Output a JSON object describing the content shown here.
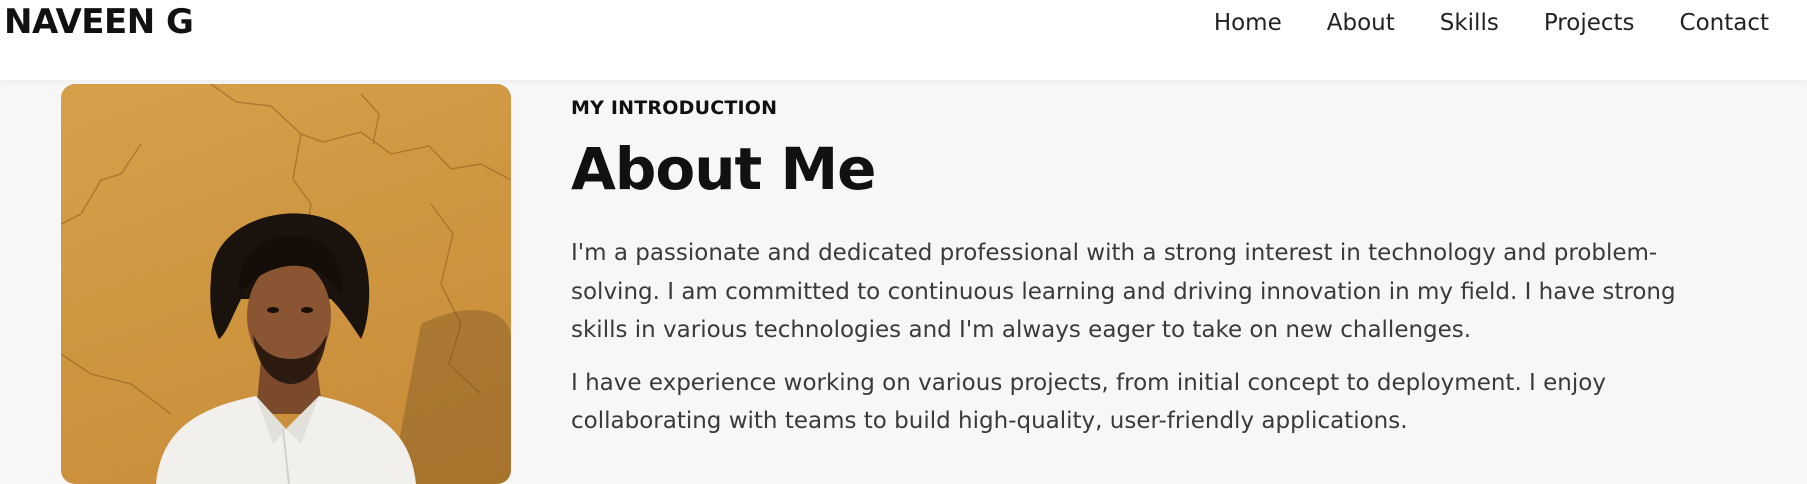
{
  "header": {
    "logo": "NAVEEN G",
    "nav": [
      "Home",
      "About",
      "Skills",
      "Projects",
      "Contact"
    ]
  },
  "about": {
    "eyebrow": "MY INTRODUCTION",
    "title": "About Me",
    "paragraphs": [
      "I'm a passionate and dedicated professional with a strong interest in technology and problem-solving. I am committed to continuous learning and driving innovation in my field. I have strong skills in various technologies and I'm always eager to take on new challenges.",
      "I have experience working on various projects, from initial concept to deployment. I enjoy collaborating with teams to build high-quality, user-friendly applications."
    ]
  },
  "colors": {
    "header_bg": "#ffffff",
    "page_bg": "#f7f7f7",
    "text_dark": "#111111",
    "text_body": "#3a3a3a",
    "photo_wall": "#d6a04a"
  }
}
